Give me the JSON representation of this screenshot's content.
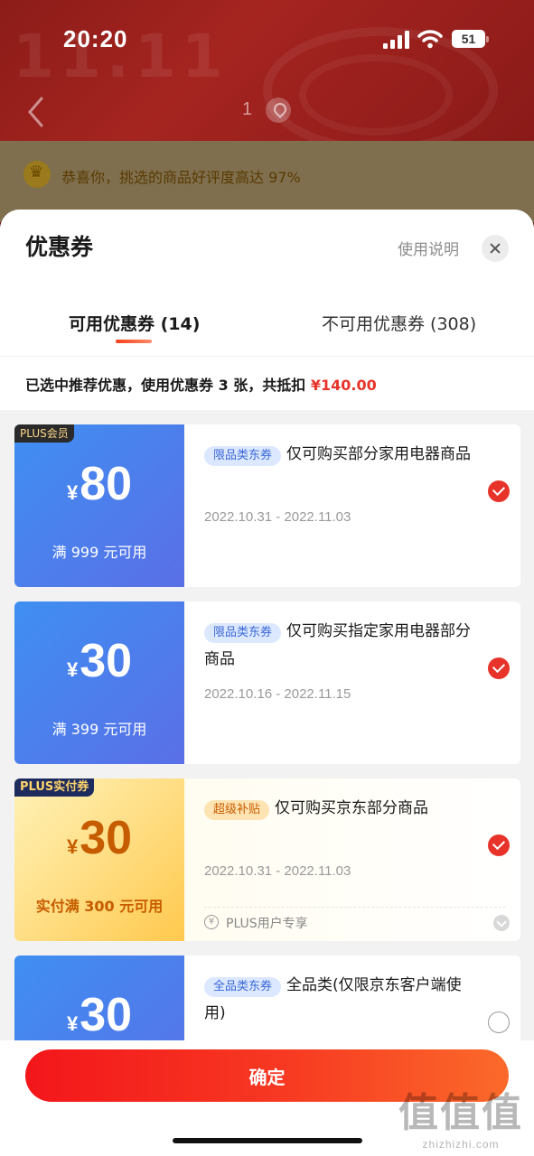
{
  "status_bar": {
    "time": "20:20",
    "battery": "51"
  },
  "nav": {
    "page_num": "1"
  },
  "notice": {
    "text": "恭喜你，挑选的商品好评度高达 97%"
  },
  "sheet": {
    "title": "优惠券",
    "help_label": "使用说明",
    "tabs": [
      {
        "label": "可用优惠券 (14)",
        "active": true
      },
      {
        "label": "不可用优惠券 (308)",
        "active": false
      }
    ],
    "summary_prefix": "已选中推荐优惠，使用优惠券 3 张，共抵扣 ",
    "summary_amount": "¥140.00"
  },
  "coupons": [
    {
      "badge": "PLUS会员",
      "currency": "¥",
      "amount": "80",
      "condition": "满 999 元可用",
      "tag": "限品类东券",
      "desc": "仅可购买部分家用电器商品",
      "date": "2022.10.31 - 2022.11.03",
      "selected": true
    },
    {
      "badge": "",
      "currency": "¥",
      "amount": "30",
      "condition": "满 399 元可用",
      "tag": "限品类东券",
      "desc": "仅可购买指定家用电器部分商品",
      "date": "2022.10.16 - 2022.11.15",
      "selected": true
    },
    {
      "badge": "PLUS实付券",
      "currency": "¥",
      "amount": "30",
      "condition": "实付满 300 元可用",
      "tag": "超级补贴",
      "desc": "仅可购买京东部分商品",
      "date": "2022.10.31 - 2022.11.03",
      "plus_note": "PLUS用户专享",
      "plus_icon": "¥",
      "selected": true
    },
    {
      "badge": "",
      "currency": "¥",
      "amount": "30",
      "condition": "",
      "tag": "全品类东券",
      "desc": "全品类(仅限京东客户端使用)",
      "date": "",
      "selected": false
    }
  ],
  "confirm_label": "确定",
  "watermark": {
    "logo": "值值值",
    "url": "zhizhizhi.com"
  },
  "colors": {
    "accent_red": "#e7332a",
    "coupon_blue": "#4f7fee",
    "coupon_gold": "#ffd36a"
  }
}
